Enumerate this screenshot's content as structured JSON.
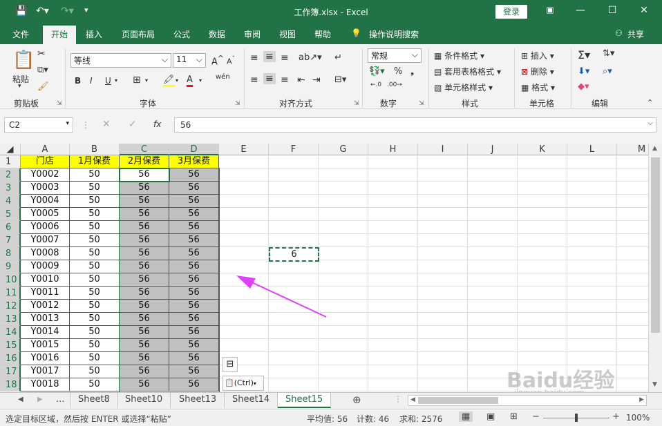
{
  "window": {
    "title": "工作簿.xlsx - Excel",
    "login": "登录"
  },
  "menu": {
    "tabs": [
      "文件",
      "开始",
      "插入",
      "页面布局",
      "公式",
      "数据",
      "审阅",
      "视图",
      "帮助"
    ],
    "search": "操作说明搜索",
    "share": "共享"
  },
  "ribbon": {
    "clipboard": {
      "label": "剪贴板",
      "paste": "粘贴"
    },
    "font": {
      "label": "字体",
      "name": "等线",
      "size": "11",
      "bold": "B",
      "italic": "I",
      "underline": "U",
      "grow": "A",
      "shrink": "A",
      "phonetic": "wén",
      "font_color": "A"
    },
    "alignment": {
      "label": "对齐方式"
    },
    "number": {
      "label": "数字",
      "format": "常规",
      "percent": "%"
    },
    "styles": {
      "label": "样式",
      "cond": "条件格式",
      "table": "套用表格格式",
      "cell": "单元格样式"
    },
    "cells": {
      "label": "单元格",
      "insert": "插入",
      "delete": "删除",
      "format": "格式"
    },
    "editing": {
      "label": "编辑"
    }
  },
  "formula_bar": {
    "name_box": "C2",
    "value": "56",
    "fx": "fx"
  },
  "sheet": {
    "columns": [
      "A",
      "B",
      "C",
      "D",
      "E",
      "F",
      "G",
      "H",
      "I",
      "J",
      "K",
      "L",
      "M"
    ],
    "header_row": [
      "门店",
      "1月保费",
      "2月保费",
      "3月保费"
    ],
    "rows": [
      [
        "Y0002",
        "50",
        "56",
        "56"
      ],
      [
        "Y0003",
        "50",
        "56",
        "56"
      ],
      [
        "Y0004",
        "50",
        "56",
        "56"
      ],
      [
        "Y0005",
        "50",
        "56",
        "56"
      ],
      [
        "Y0006",
        "50",
        "56",
        "56"
      ],
      [
        "Y0007",
        "50",
        "56",
        "56"
      ],
      [
        "Y0008",
        "50",
        "56",
        "56"
      ],
      [
        "Y0009",
        "50",
        "56",
        "56"
      ],
      [
        "Y0010",
        "50",
        "56",
        "56"
      ],
      [
        "Y0011",
        "50",
        "56",
        "56"
      ],
      [
        "Y0012",
        "50",
        "56",
        "56"
      ],
      [
        "Y0013",
        "50",
        "56",
        "56"
      ],
      [
        "Y0014",
        "50",
        "56",
        "56"
      ],
      [
        "Y0015",
        "50",
        "56",
        "56"
      ],
      [
        "Y0016",
        "50",
        "56",
        "56"
      ],
      [
        "Y0017",
        "50",
        "56",
        "56"
      ],
      [
        "Y0018",
        "50",
        "56",
        "56"
      ]
    ],
    "f8_value": "6",
    "paste_options": "(Ctrl)"
  },
  "sheets": {
    "more": "...",
    "tabs": [
      "Sheet8",
      "Sheet10",
      "Sheet13",
      "Sheet14",
      "Sheet15"
    ],
    "active": "Sheet15"
  },
  "status": {
    "message": "选定目标区域，然后按 ENTER 或选择“粘贴”",
    "average": "平均值: 56",
    "count": "计数: 46",
    "sum": "求和: 2576",
    "zoom": "100%"
  },
  "watermark": {
    "text": "Baidu经验",
    "url": "jingyan.baidu.com"
  },
  "colors": {
    "excel_green": "#217346",
    "header_yellow": "#ffff00",
    "copy_gray": "#c0c0c0",
    "arrow": "#e040fb"
  }
}
